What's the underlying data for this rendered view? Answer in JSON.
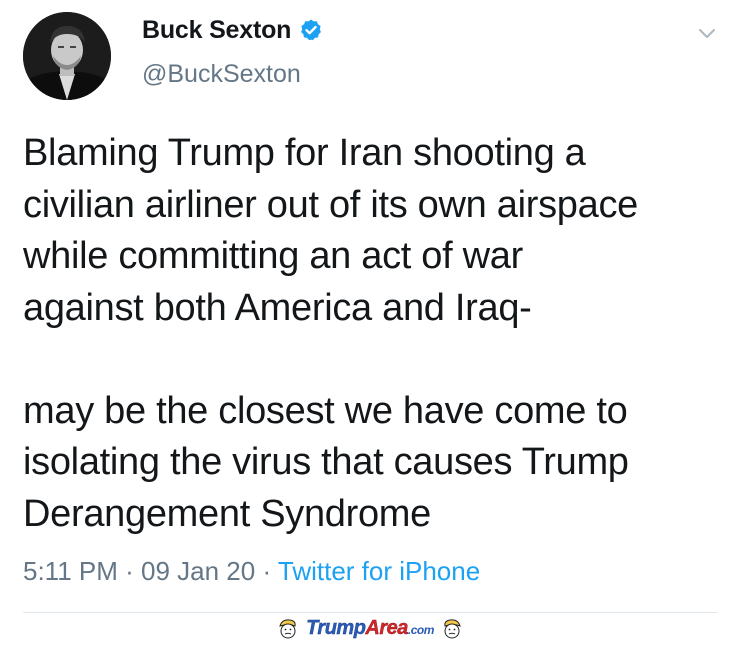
{
  "author": {
    "name": "Buck Sexton",
    "handle": "@BuckSexton",
    "verified": true
  },
  "tweet": {
    "paragraphs": [
      "Blaming Trump for Iran shooting a\ncivilian airliner out of its own airspace\nwhile committing an act of war\nagainst both America and Iraq-",
      "may be the closest we have come to\nisolating the virus that causes Trump\nDerangement Syndrome"
    ]
  },
  "meta": {
    "time": "5:11 PM",
    "separator": " · ",
    "date": "09 Jan 20",
    "source": "Twitter for iPhone"
  },
  "watermark": {
    "part1": "Trump",
    "part2": "Area",
    "part3": ".com"
  },
  "colors": {
    "text": "#14171a",
    "secondary": "#657786",
    "link": "#1da1f2",
    "verified": "#1da1f2"
  },
  "icons": [
    "verified-badge-icon",
    "chevron-down-icon",
    "watermark-face-icon"
  ]
}
